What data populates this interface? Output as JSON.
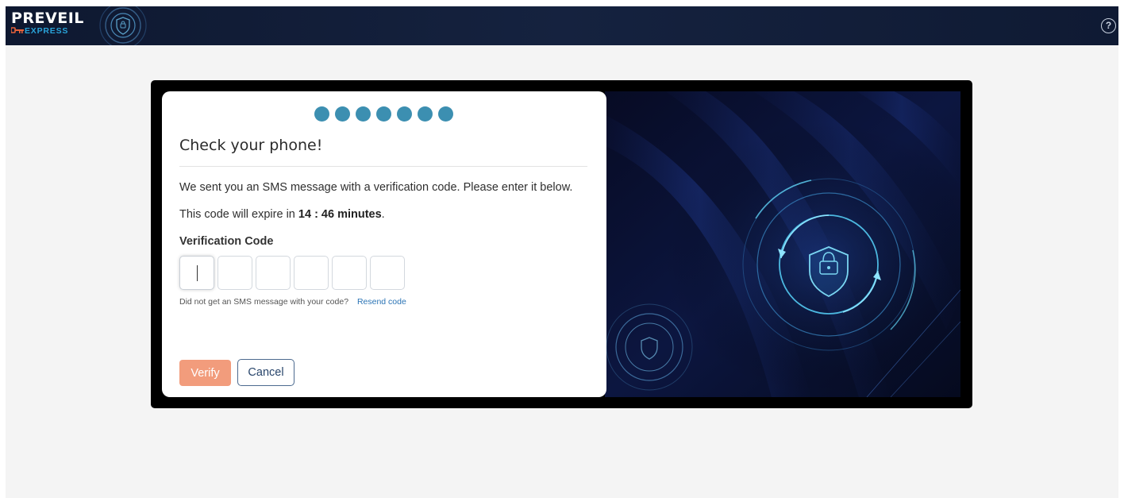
{
  "app": {
    "logo_main": "PREVEIL",
    "logo_sub": "EXPRESS",
    "help_symbol": "?"
  },
  "icons": {
    "logo": "key-icon",
    "topbar_emblem": "shield-lock-icon",
    "help": "help-circle-icon",
    "hero_shield": "shield-lock-icon"
  },
  "colors": {
    "topbar": "#15223f",
    "step_dot": "#3c8fb1",
    "verify_button": "#f29c7c",
    "cancel_border": "#4c6a8f",
    "link": "#2b74b5",
    "logo_accent": "#29a3d9",
    "key_accent": "#e8623a"
  },
  "card": {
    "steps_total": 7,
    "title": "Check your phone!",
    "message": "We sent you an SMS message with a verification code. Please enter it below.",
    "expire_prefix": "This code will expire in",
    "expire_time": "14 : 46 minutes",
    "expire_suffix": ".",
    "code_label": "Verification Code",
    "code_length": 6,
    "code_value": "",
    "resend_prompt": "Did not get an SMS message with your code?",
    "resend_link": "Resend code",
    "verify_label": "Verify",
    "cancel_label": "Cancel"
  }
}
